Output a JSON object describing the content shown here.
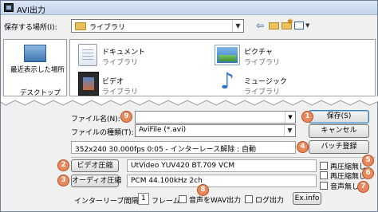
{
  "window": {
    "title": "AVI出力"
  },
  "location": {
    "label": "保存する場所(I):",
    "value": "ライブラリ"
  },
  "toolbar": {
    "icons": [
      "back-arrow-icon",
      "up-folder-icon",
      "new-folder-icon",
      "view-menu-icon"
    ]
  },
  "places": [
    {
      "label": "最近表示した場所",
      "icon": "recent-places-icon"
    },
    {
      "label": "デスクトップ",
      "icon": "desktop-icon"
    }
  ],
  "libraries": [
    {
      "name": "ドキュメント",
      "sub": "ライブラリ",
      "icon": "documents-icon"
    },
    {
      "name": "ピクチャ",
      "sub": "ライブラリ",
      "icon": "pictures-icon"
    },
    {
      "name": "ビデオ",
      "sub": "ライブラリ",
      "icon": "video-icon"
    },
    {
      "name": "ミュージック",
      "sub": "ライブラリ",
      "icon": "music-icon"
    }
  ],
  "form": {
    "filename_label": "ファイル名(N):",
    "filename_value": "",
    "filetype_label": "ファイルの種類(T):",
    "filetype_value": "AviFile (*.avi)",
    "save_label": "保存(S)",
    "cancel_label": "キャンセル",
    "info_text": "352x240  30.000fps  0:05  -  インターレース解除 : 自動",
    "batch_label": "バッチ登録",
    "video_compress_label": "ビデオ圧縮",
    "video_codec": "UtVideo YUV420 BT.709 VCM",
    "audio_compress_label": "オーディオ圧縮",
    "audio_format": "PCM 44.100kHz 2ch",
    "recompress_none_1": "再圧縮無し",
    "recompress_none_2": "再圧縮無し",
    "no_audio": "音声無し",
    "interleave_label": "インターリーブ間隔 :",
    "interleave_value": "1",
    "frame_unit": "フレーム",
    "wav_output": "音声をWAV出力",
    "log_output": "ログ出力",
    "exinfo_label": "Ex.info"
  },
  "badges": [
    "1",
    "2",
    "3",
    "4",
    "5",
    "6",
    "7",
    "8",
    "9"
  ],
  "colors": {
    "badge": "#e9885a",
    "titlebar": "#c4d5ec"
  }
}
